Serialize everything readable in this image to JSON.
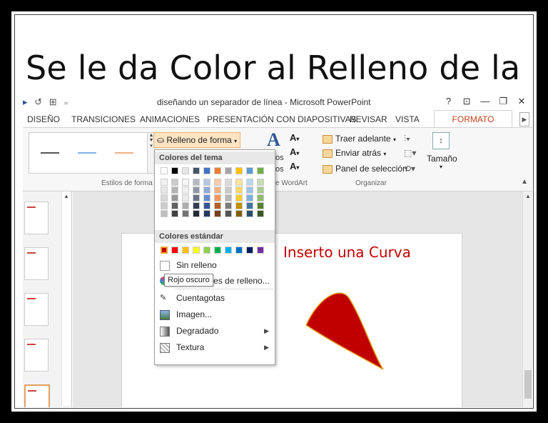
{
  "headline": "Se le da Color al Relleno de la Curva",
  "window": {
    "title": "diseñando un separador de línea - Microsoft PowerPoint",
    "help": "?",
    "controls": [
      "⊡",
      "—",
      "❐",
      "✕"
    ]
  },
  "tabs": [
    "DISEÑO",
    "TRANSICIONES",
    "ANIMACIONES",
    "PRESENTACIÓN CON DIAPOSITIVAS",
    "REVISAR",
    "VISTA",
    "FORMATO"
  ],
  "ribbon": {
    "styles_group": "Estilos de forma",
    "fill_button": "Relleno de forma",
    "wordart_group": "e WordArt",
    "wordart_a": "A",
    "organize_group": "Organizar",
    "organize_items": [
      "Traer adelante",
      "Enviar atrás",
      "Panel de selección"
    ],
    "size_label": "Tamaño",
    "wordart_side_1": "os",
    "wordart_side_2": "os"
  },
  "dropdown": {
    "theme_colors_label": "Colores del tema",
    "standard_colors_label": "Colores estándar",
    "no_fill": "Sin relleno",
    "more_colors": "Más colores de relleno...",
    "eyedropper": "Cuentagotas",
    "image": "Imagen...",
    "gradient": "Degradado",
    "texture": "Textura",
    "tooltip": "Rojo oscuro"
  },
  "slide": {
    "title": "Inserto una Curva"
  },
  "colors": {
    "accent": "#c43e1c",
    "curve_fill": "#c00000",
    "theme_row": [
      "#ffffff",
      "#000000",
      "#e7e6e6",
      "#44546a",
      "#4472c4",
      "#ed7d31",
      "#a5a5a5",
      "#ffc000",
      "#5b9bd5",
      "#70ad47"
    ],
    "standard_row": [
      "#c00000",
      "#ff0000",
      "#ffc000",
      "#ffff00",
      "#92d050",
      "#00b050",
      "#00b0f0",
      "#0070c0",
      "#002060",
      "#7030a0"
    ]
  }
}
